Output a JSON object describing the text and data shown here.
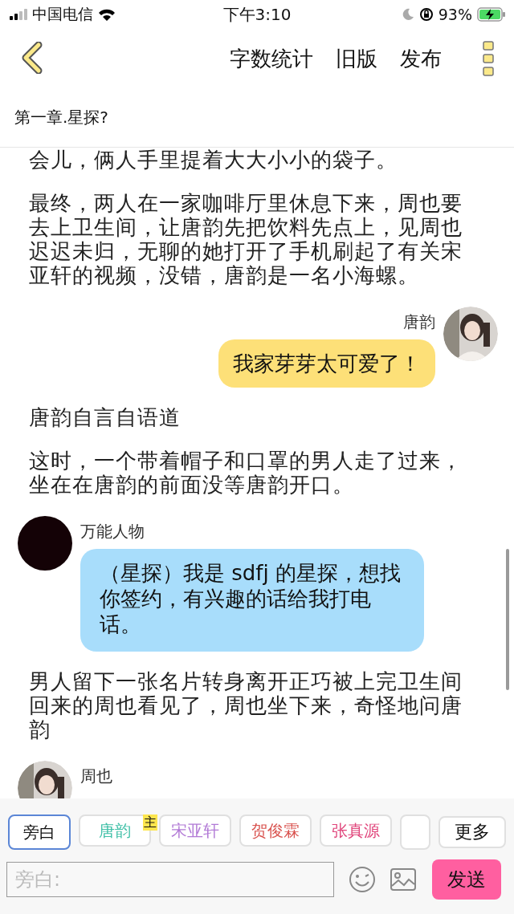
{
  "status_bar": {
    "carrier": "中国电信",
    "time": "下午3:10",
    "battery": "93%"
  },
  "nav": {
    "actions": [
      "字数统计",
      "旧版",
      "发布"
    ]
  },
  "chapter_title": "第一章.星探?",
  "content": [
    {
      "kind": "narration",
      "text": "会儿，俩人手里提着大大小小的袋子。"
    },
    {
      "kind": "narration",
      "text": "最终，两人在一家咖啡厅里休息下来，周也要去上卫生间，让唐韵先把饮料先点上，见周也迟迟未归，无聊的她打开了手机刷起了有关宋亚轩的视频，没错，唐韵是一名小海螺。"
    },
    {
      "kind": "message_right",
      "name": "唐韵",
      "text": "我家芽芽太可爱了！"
    },
    {
      "kind": "narration",
      "text": "唐韵自言自语道"
    },
    {
      "kind": "narration",
      "text": "这时，一个带着帽子和口罩的男人走了过来，坐在在唐韵的前面没等唐韵开口。"
    },
    {
      "kind": "message_left",
      "avatar": {
        "kind": "dark"
      },
      "name": "万能人物",
      "text": "（星探）我是 sdfj 的星探，想找你签约，有兴趣的话给我打电话。"
    },
    {
      "kind": "narration",
      "text": "男人留下一张名片转身离开正巧被上完卫生间回来的周也看见了，周也坐下来，奇怪地问唐韵"
    },
    {
      "kind": "message_left",
      "name": "周也"
    }
  ],
  "characters": [
    {
      "label": "旁白",
      "selected": true,
      "color": "#111111"
    },
    {
      "label": "唐韵",
      "selected": false,
      "color": "#3dbfa6",
      "badge": "主"
    },
    {
      "label": "宋亚轩",
      "selected": false,
      "color": "#b27ad6"
    },
    {
      "label": "贺俊霖",
      "selected": false,
      "color": "#d9534f"
    },
    {
      "label": "张真源",
      "selected": false,
      "color": "#e0457b"
    }
  ],
  "more_button": "更多",
  "input": {
    "placeholder": "旁白:"
  },
  "send_button": "发送"
}
